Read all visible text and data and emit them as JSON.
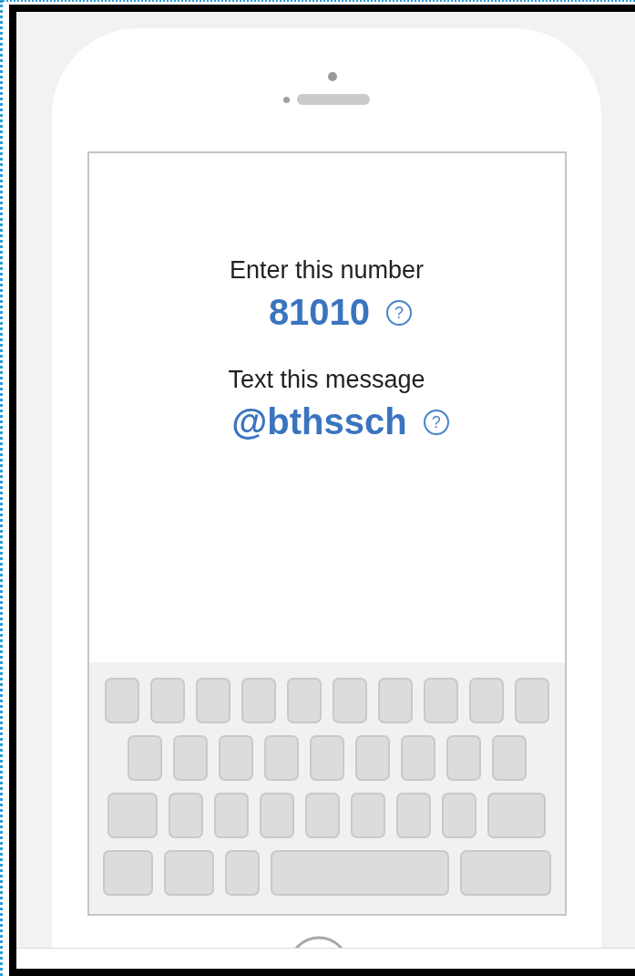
{
  "prompts": [
    {
      "label": "Enter this number",
      "value": "81010",
      "help": "?"
    },
    {
      "label": "Text this message",
      "value": "@bthssch",
      "help": "?"
    }
  ]
}
